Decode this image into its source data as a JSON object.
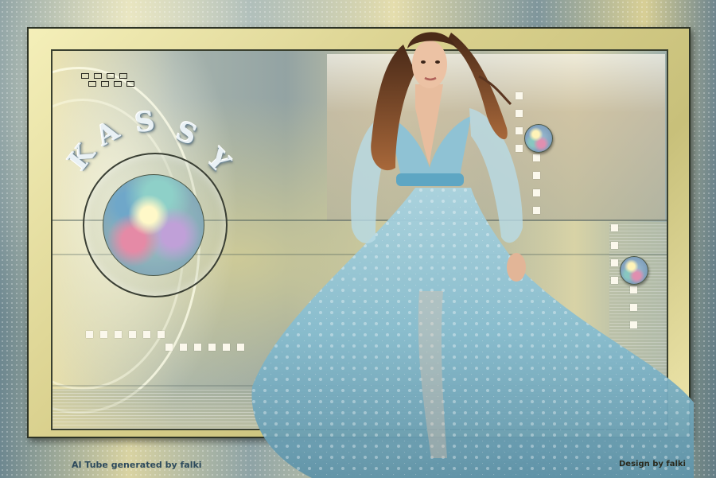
{
  "artwork": {
    "title": "KASSY",
    "credit_left": "AI Tube generated by falki",
    "credit_right": "Design by falki",
    "palette": {
      "frame_gold": "#d9d08d",
      "background_teal": "#8ea3a6",
      "dress_blue": "#8ec3d6",
      "title_white": "#e9f1f5",
      "credit_left_color": "#2d4a5c",
      "credit_right_color": "#2a2a1e"
    },
    "subject": "woman-in-blue-gown"
  }
}
